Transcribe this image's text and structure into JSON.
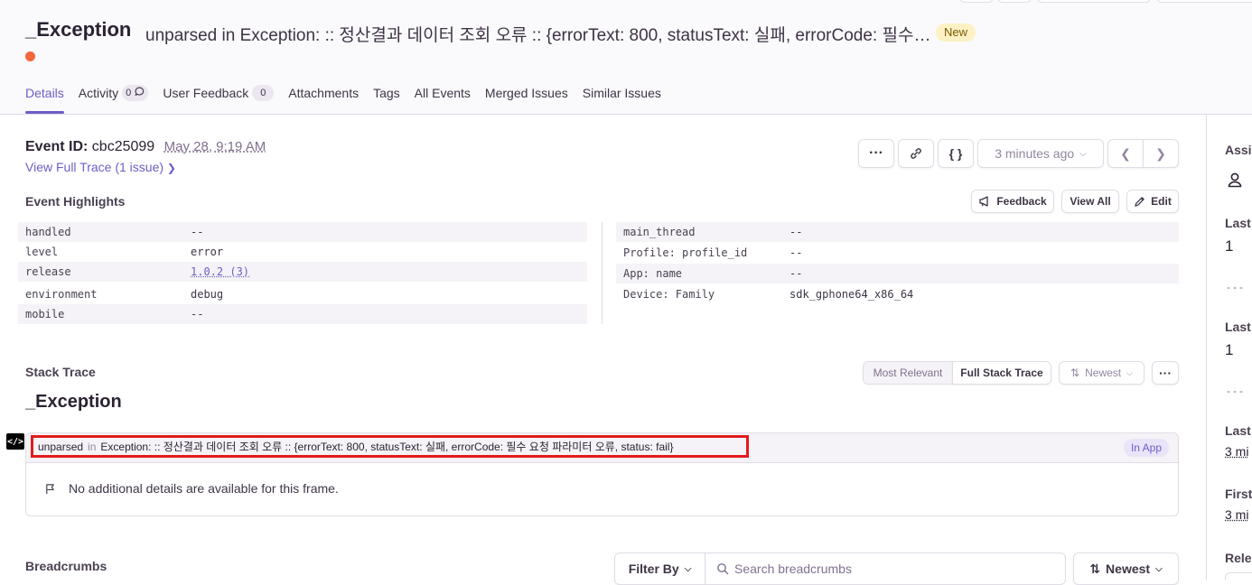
{
  "issue": {
    "title": "_Exception",
    "subtitle": "unparsed in Exception: :: 정산결과 데이터 조회 오류 :: {errorText: 800, statusText: 실패, errorCode: 필수 요청 파라미터 오류, status: fail}",
    "badge": "New"
  },
  "tabs": [
    {
      "label": "Details"
    },
    {
      "label": "Activity",
      "count": "0"
    },
    {
      "label": "User Feedback",
      "count": "0"
    },
    {
      "label": "Attachments"
    },
    {
      "label": "Tags"
    },
    {
      "label": "All Events"
    },
    {
      "label": "Merged Issues"
    },
    {
      "label": "Similar Issues"
    }
  ],
  "event": {
    "id_label": "Event ID:",
    "id_value": "cbc25099",
    "date": "May 28, 9:19 AM",
    "trace_link": "View Full Trace (1 issue)",
    "time_selector": "3 minutes ago"
  },
  "highlights": {
    "title": "Event Highlights",
    "feedback_btn": "Feedback",
    "view_all_btn": "View All",
    "edit_btn": "Edit",
    "left": [
      {
        "key": "handled",
        "value": "--"
      },
      {
        "key": "level",
        "value": "error"
      },
      {
        "key": "release",
        "value": "1.0.2 (3)"
      },
      {
        "key": "environment",
        "value": "debug"
      },
      {
        "key": "mobile",
        "value": "--"
      }
    ],
    "right": [
      {
        "key": "main_thread",
        "value": "--"
      },
      {
        "key": "Profile: profile_id",
        "value": "--"
      },
      {
        "key": "App: name",
        "value": "--"
      },
      {
        "key": "Device: Family",
        "value": "sdk_gphone64_x86_64"
      }
    ]
  },
  "stack_trace": {
    "title": "Stack Trace",
    "most_relevant": "Most Relevant",
    "full_stack_trace": "Full Stack Trace",
    "sort": "Newest",
    "exception_type": "_Exception",
    "frame_module": "unparsed",
    "frame_in": "in",
    "frame_function": "Exception: :: 정산결과 데이터 조회 오류 :: {errorText: 800, statusText: 실패, errorCode: 필수 요청 파라미터 오류, status: fail}",
    "in_app": "In App",
    "no_details": "No additional details are available for this frame."
  },
  "breadcrumbs": {
    "title": "Breadcrumbs",
    "filter": "Filter By",
    "search_placeholder": "Search breadcrumbs",
    "sort": "Newest"
  },
  "sidebar": {
    "assignee_label": "Assi",
    "last1_label": "Last",
    "last1_value": "1",
    "last2_label": "Last",
    "last2_value": "1",
    "last3_label": "Last",
    "last3_value": "3 mi",
    "first_label": "First",
    "first_value": "3 mi",
    "release_label": "Rele"
  }
}
